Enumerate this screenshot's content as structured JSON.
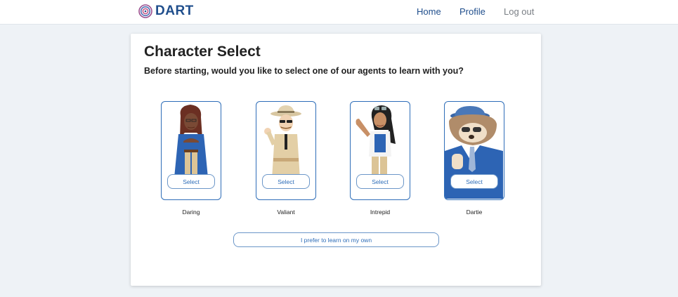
{
  "header": {
    "logo_text": "DART",
    "nav": {
      "home": "Home",
      "profile": "Profile",
      "logout": "Log out"
    }
  },
  "page": {
    "title": "Character Select",
    "subtitle": "Before starting, would you like to select one of our agents to learn with you?"
  },
  "agents": [
    {
      "name": "Daring",
      "button": "Select"
    },
    {
      "name": "Valiant",
      "button": "Select"
    },
    {
      "name": "Intrepid",
      "button": "Select"
    },
    {
      "name": "Dartie",
      "button": "Select"
    }
  ],
  "own_button": "I prefer to learn on my own",
  "colors": {
    "brand": "#1f4e8c",
    "accent": "#2e6db8",
    "background": "#eef2f6"
  }
}
